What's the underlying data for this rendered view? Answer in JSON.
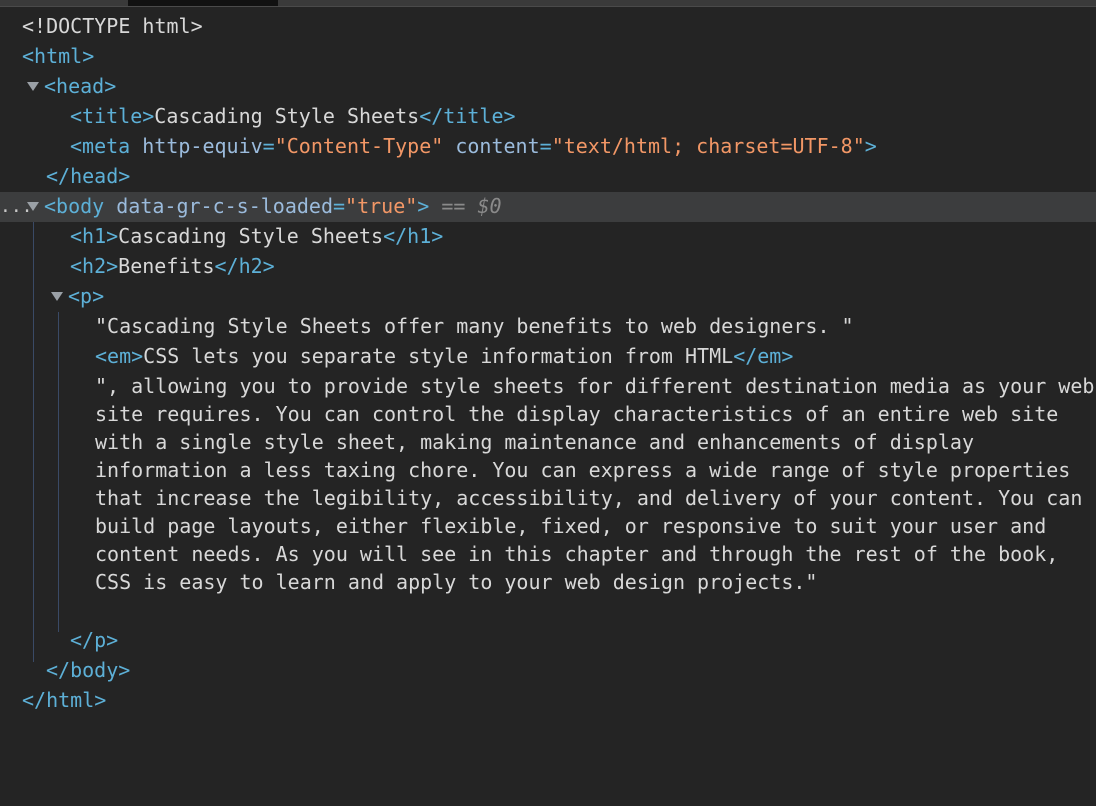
{
  "doctype": "<!DOCTYPE html>",
  "tokens": {
    "html_open": "<html>",
    "html_close": "</html>",
    "head_open": "<head>",
    "head_close": "</head>",
    "title_open": "<title>",
    "title_close": "</title>",
    "meta_open": "<meta ",
    "meta_attr1": "http-equiv",
    "meta_val1": "\"Content-Type\"",
    "meta_attr2": "content",
    "meta_val2": "\"text/html; charset=UTF-8\"",
    "meta_end": ">",
    "body_open": "<body ",
    "body_attr": "data-gr-c-s-loaded",
    "body_val": "\"true\"",
    "body_end": ">",
    "body_close": "</body>",
    "h1_open": "<h1>",
    "h1_close": "</h1>",
    "h2_open": "<h2>",
    "h2_close": "</h2>",
    "p_open": "<p>",
    "p_close": "</p>",
    "em_open": "<em>",
    "em_close": "</em>",
    "eq": "=",
    "sel_marker": "== ",
    "sel_var": "$0",
    "ellipsis": "..."
  },
  "content": {
    "title_text": "Cascading Style Sheets",
    "h1_text": "Cascading Style Sheets",
    "h2_text": "Benefits",
    "p_text1": "\"Cascading Style Sheets offer many benefits to web designers. \"",
    "em_text": "CSS lets you separate style information from HTML",
    "p_text2": "\", allowing you to provide style sheets for different destination media as your web site requires. You can control the display characteristics of an entire web site with a single style sheet, making maintenance and enhancements of display information a less taxing chore. You can express a wide range of style properties that increase the legibility, accessibility, and delivery of your content. You can build page layouts, either flexible, fixed, or responsive to suit your user and content needs. As you will see in this chapter and through the rest of the book, CSS is easy to learn and apply to your web design projects.\""
  },
  "colors": {
    "background": "#242424",
    "tag": "#5db0d7",
    "attribute": "#9bbbdc",
    "value": "#f29766",
    "text": "#d8d8d8",
    "selected_row": "#3c3d3e"
  }
}
